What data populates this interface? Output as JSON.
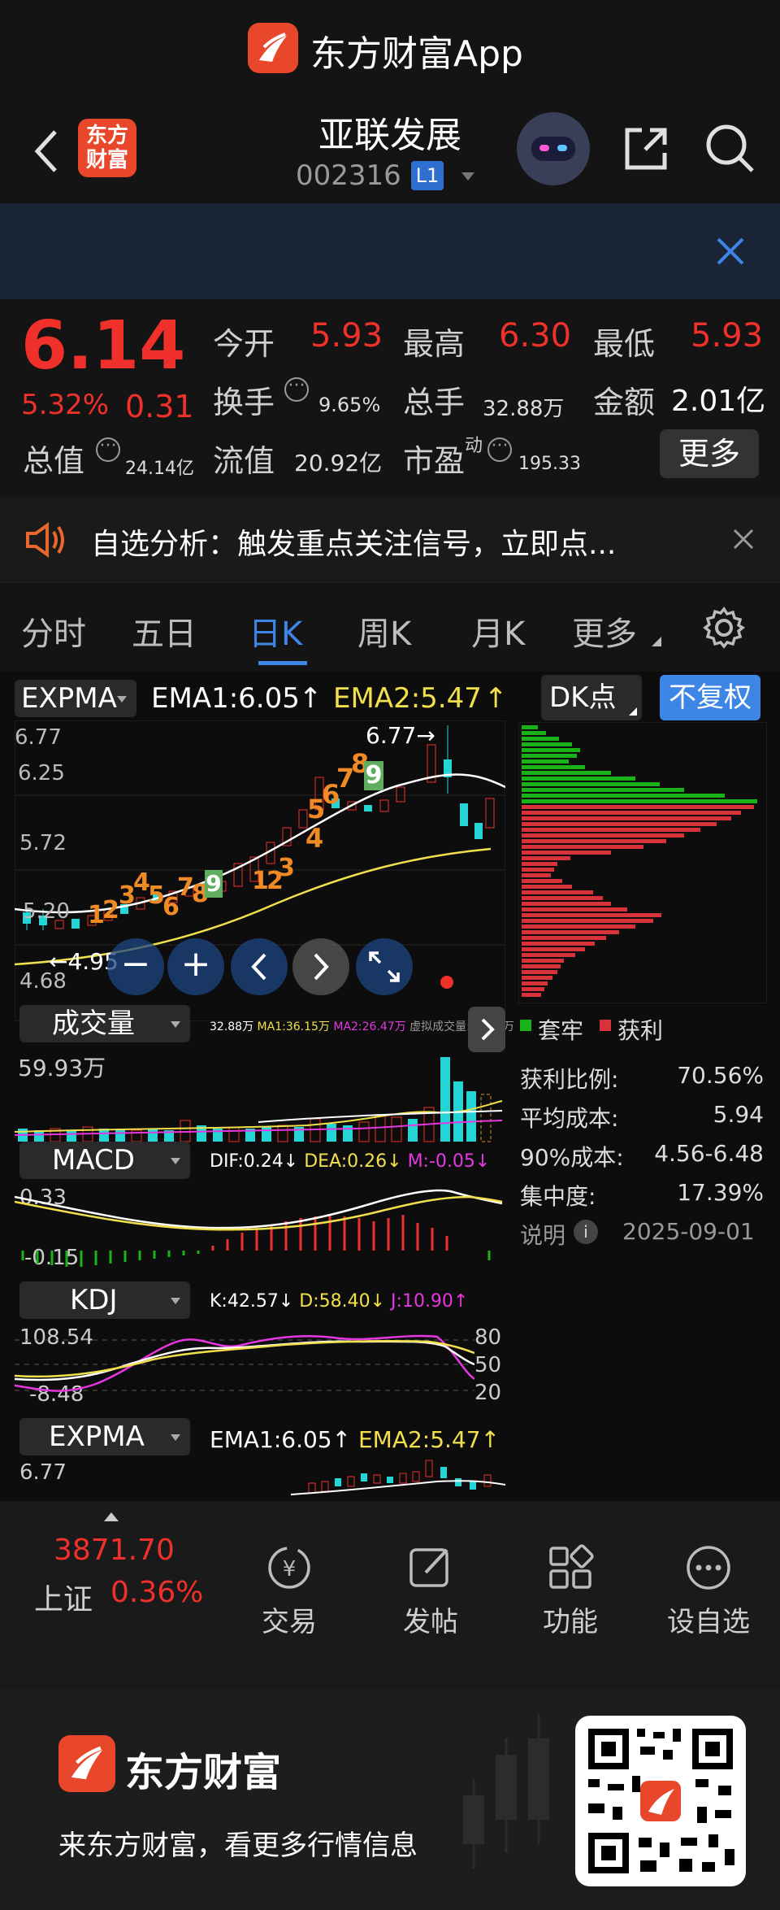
{
  "app_banner": {
    "name": "东方财富App"
  },
  "header": {
    "back_logo_text": "东方财富",
    "stock_name": "亚联发展",
    "stock_code": "002316",
    "level_badge": "L1"
  },
  "quote": {
    "price": "6.14",
    "change_pct": "5.32%",
    "change_amt": "0.31",
    "open_label": "今开",
    "open": "5.93",
    "high_label": "最高",
    "high": "6.30",
    "low_label": "最低",
    "low": "5.93",
    "turnover_label": "换手",
    "turnover": "9.65%",
    "volume_label": "总手",
    "volume": "32.88万",
    "amount_label": "金额",
    "amount": "2.01亿",
    "mktcap_label": "总值",
    "mktcap": "24.14亿",
    "float_label": "流值",
    "float_cap": "20.92亿",
    "pe_label": "市盈",
    "pe_sup": "动",
    "pe": "195.33",
    "more_button": "更多"
  },
  "notice": {
    "text": "自选分析：触发重点关注信号，立即点..."
  },
  "tabs": [
    "分时",
    "五日",
    "日K",
    "周K",
    "月K",
    "更多"
  ],
  "active_tab": "日K",
  "main_indicator": {
    "name": "EXPMA",
    "ema1": "EMA1:6.05",
    "ema2": "EMA2:5.47",
    "dk_button": "DK点",
    "adjust_button": "不复权",
    "price_ticks": [
      "6.77",
      "6.25",
      "5.72",
      "5.20",
      "4.68"
    ],
    "high_marker": "6.77→",
    "low_marker": "←4.95",
    "seq_numbers_top": [
      "4",
      "5",
      "6",
      "7",
      "8",
      "9"
    ],
    "seq_numbers_bottom": [
      "1",
      "2",
      "3",
      "4",
      "5",
      "6",
      "7",
      "8",
      "9"
    ],
    "seq_numbers_mid": [
      "1",
      "2",
      "3"
    ]
  },
  "chips": {
    "legend_trap": "套牢",
    "legend_profit": "获利",
    "profit_ratio_label": "获利比例:",
    "profit_ratio": "70.56%",
    "avg_cost_label": "平均成本:",
    "avg_cost": "5.94",
    "cost90_label": "90%成本:",
    "cost90": "4.56-6.48",
    "concentration_label": "集中度:",
    "concentration": "17.39%",
    "note_label": "说明",
    "date": "2025-09-01"
  },
  "volume": {
    "name": "成交量",
    "vol": "32.88万",
    "ma1": "MA1:36.15万",
    "ma2": "MA2:26.47万",
    "virtual": "虚拟成交量:36.58万",
    "max_tick": "59.93万"
  },
  "macd": {
    "name": "MACD",
    "dif": "DIF:0.24",
    "dea": "DEA:0.26",
    "m": "M:-0.05",
    "tick_top": "0.33",
    "tick_bottom": "-0.15"
  },
  "kdj": {
    "name": "KDJ",
    "k": "K:42.57",
    "d": "D:58.40",
    "j": "J:10.90",
    "tick_top": "108.54",
    "tick_bottom": "-8.48",
    "levels": [
      "80",
      "50",
      "20"
    ]
  },
  "expma2": {
    "name": "EXPMA",
    "ema1": "EMA1:6.05",
    "ema2": "EMA2:5.47",
    "tick_top": "6.77"
  },
  "bottom_nav": {
    "index_value": "3871.70",
    "index_name": "上证",
    "index_pct": "0.36%",
    "items": [
      "交易",
      "发帖",
      "功能",
      "设自选"
    ]
  },
  "footer": {
    "brand": "东方财富",
    "slogan": "来东方财富，看更多行情信息"
  },
  "colors": {
    "up": "#f0302a",
    "down": "#25d5d5",
    "accent": "#3d86e6",
    "ema2": "#f1e04b"
  }
}
